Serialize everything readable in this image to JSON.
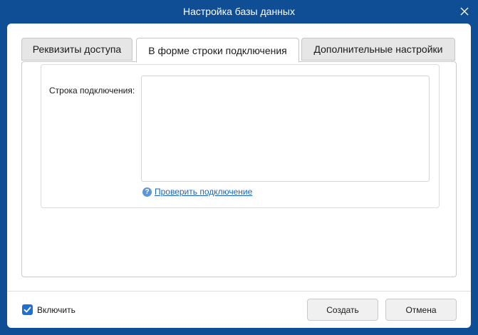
{
  "window": {
    "title": "Настройка базы данных"
  },
  "tabs": [
    {
      "label": "Реквизиты доступа",
      "active": false
    },
    {
      "label": "В форме строки подключения",
      "active": true
    },
    {
      "label": "Дополнительные настройки",
      "active": false
    }
  ],
  "form": {
    "connection_label": "Строка подключения:",
    "connection_value": "",
    "check_link": "Проверить подключение"
  },
  "footer": {
    "enable_label": "Включить",
    "enable_checked": true,
    "create_label": "Создать",
    "cancel_label": "Отмена"
  },
  "colors": {
    "frame": "#0f4d94",
    "accent": "#1f6fd1",
    "link": "#1a66c4"
  }
}
